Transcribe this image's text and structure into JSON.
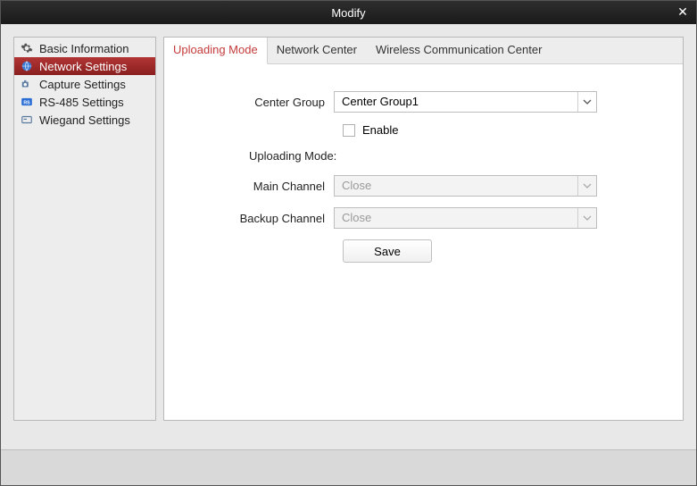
{
  "window": {
    "title": "Modify"
  },
  "sidebar": {
    "items": [
      {
        "label": "Basic Information"
      },
      {
        "label": "Network Settings"
      },
      {
        "label": "Capture Settings"
      },
      {
        "label": "RS-485 Settings"
      },
      {
        "label": "Wiegand Settings"
      }
    ],
    "active_index": 1
  },
  "tabs": {
    "items": [
      {
        "label": "Uploading Mode"
      },
      {
        "label": "Network Center"
      },
      {
        "label": "Wireless Communication Center"
      }
    ],
    "active_index": 0
  },
  "form": {
    "center_group_label": "Center Group",
    "center_group_value": "Center Group1",
    "enable_label": "Enable",
    "enable_checked": false,
    "uploading_mode_label": "Uploading Mode:",
    "main_channel_label": "Main Channel",
    "main_channel_value": "Close",
    "backup_channel_label": "Backup Channel",
    "backup_channel_value": "Close",
    "save_label": "Save"
  }
}
